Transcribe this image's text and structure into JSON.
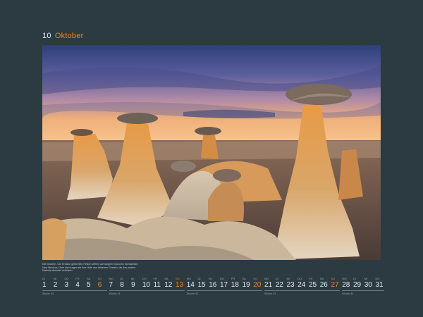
{
  "header": {
    "month_number": "10",
    "month_name": "Oktober"
  },
  "caption": "Die bizarren, von Erosion geformten Felsen stehen auf kargem Grund im Nordwesten New Mexicos. Über sich tragen sie ihre Hüte aus härterem Gestein, die das weiche Material darunter schützen.",
  "calendar": {
    "sunday_color": "#e6862a",
    "days": [
      {
        "n": "1",
        "w": "DI",
        "sun": false
      },
      {
        "n": "2",
        "w": "MI",
        "sun": false
      },
      {
        "n": "3",
        "w": "DO",
        "sun": false
      },
      {
        "n": "4",
        "w": "FR",
        "sun": false
      },
      {
        "n": "5",
        "w": "SA",
        "sun": false
      },
      {
        "n": "6",
        "w": "SO",
        "sun": true
      },
      {
        "n": "7",
        "w": "MO",
        "sun": false
      },
      {
        "n": "8",
        "w": "DI",
        "sun": false
      },
      {
        "n": "9",
        "w": "MI",
        "sun": false
      },
      {
        "n": "10",
        "w": "DO",
        "sun": false
      },
      {
        "n": "11",
        "w": "FR",
        "sun": false
      },
      {
        "n": "12",
        "w": "SA",
        "sun": false
      },
      {
        "n": "13",
        "w": "SO",
        "sun": true
      },
      {
        "n": "14",
        "w": "MO",
        "sun": false
      },
      {
        "n": "15",
        "w": "DI",
        "sun": false
      },
      {
        "n": "16",
        "w": "MI",
        "sun": false
      },
      {
        "n": "17",
        "w": "DO",
        "sun": false
      },
      {
        "n": "18",
        "w": "FR",
        "sun": false
      },
      {
        "n": "19",
        "w": "SA",
        "sun": false
      },
      {
        "n": "20",
        "w": "SO",
        "sun": true
      },
      {
        "n": "21",
        "w": "MO",
        "sun": false
      },
      {
        "n": "22",
        "w": "DI",
        "sun": false
      },
      {
        "n": "23",
        "w": "MI",
        "sun": false
      },
      {
        "n": "24",
        "w": "DO",
        "sun": false
      },
      {
        "n": "25",
        "w": "FR",
        "sun": false
      },
      {
        "n": "26",
        "w": "SA",
        "sun": false
      },
      {
        "n": "27",
        "w": "SO",
        "sun": true
      },
      {
        "n": "28",
        "w": "MO",
        "sun": false
      },
      {
        "n": "29",
        "w": "DI",
        "sun": false
      },
      {
        "n": "30",
        "w": "MI",
        "sun": false
      },
      {
        "n": "31",
        "w": "DO",
        "sun": false
      }
    ],
    "weeks": [
      "Woche 40",
      "Woche 41",
      "Woche 42",
      "Woche 43",
      "Woche 44"
    ]
  }
}
